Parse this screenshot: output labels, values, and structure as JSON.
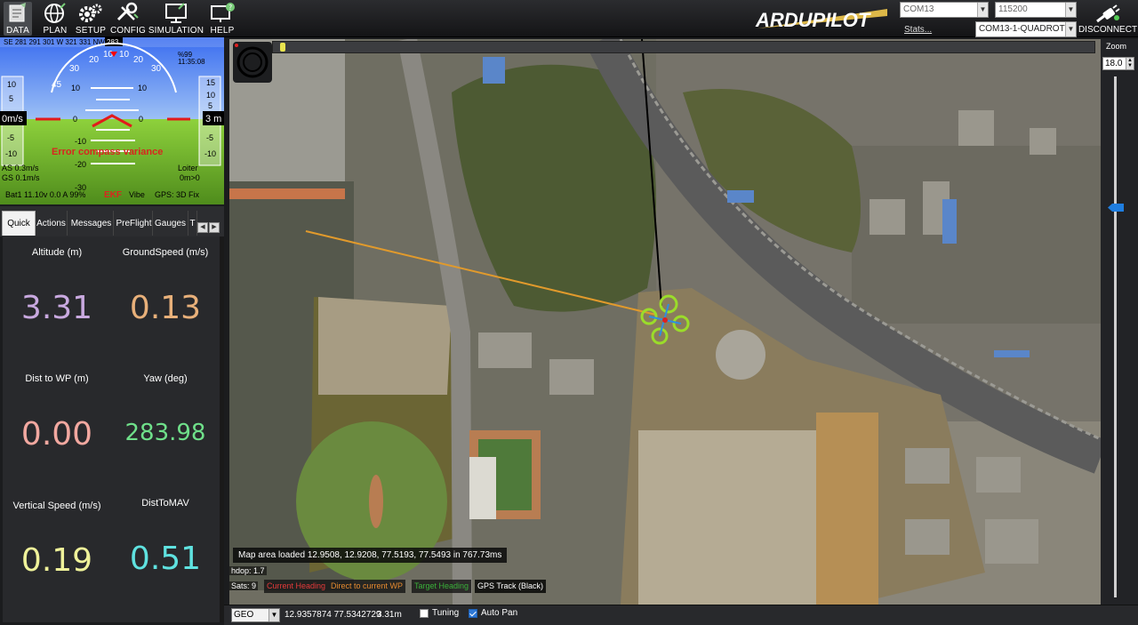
{
  "toolbar": {
    "data": "DATA",
    "plan": "PLAN",
    "setup": "SETUP",
    "config": "CONFIG",
    "simulation": "SIMULATION",
    "help": "HELP",
    "logo": "ARDUPILOT",
    "com_port": "COM13",
    "baud": "115200",
    "stats": "Stats...",
    "vehicle": "COM13-1-QUADROTOR",
    "disconnect": "DISCONNECT"
  },
  "hud": {
    "heading_row": "SE 281 291 301 W 321 331 NW 351",
    "heading_value": "283",
    "left_speed": "0m/s",
    "right_alt": "3 m",
    "pitch_labels": [
      "10",
      "0",
      "-10",
      "-20",
      "-30"
    ],
    "pitch_right": [
      "10",
      "0",
      "-10"
    ],
    "roll_labels": [
      "30",
      "20",
      "10",
      "0",
      "10",
      "20",
      "30",
      "45"
    ],
    "speed_scale": [
      "10",
      "5",
      "-5",
      "-10"
    ],
    "alt_scale": [
      "15",
      "10",
      "5",
      "-5",
      "-10"
    ],
    "error_msg": "Error compass variance",
    "as": "AS 0.3m/s",
    "gs": "GS 0.1m/s",
    "mode": "Loiter",
    "dist": "0m>0",
    "battery": "Bat1 11.10v 0.0 A 99%",
    "ekf": "EKF",
    "vibe": "Vibe",
    "gps": "GPS: 3D Fix",
    "time": "11:35:08",
    "signal": "%99"
  },
  "tabs": [
    "Quick",
    "Actions",
    "Messages",
    "PreFlight",
    "Gauges",
    "T"
  ],
  "quick": [
    {
      "label": "Altitude (m)",
      "value": "3.31",
      "color": "#c9a9e0"
    },
    {
      "label": "GroundSpeed (m/s)",
      "value": "0.13",
      "color": "#e8b07a"
    },
    {
      "label": "Dist to WP (m)",
      "value": "0.00",
      "color": "#f2a8a0"
    },
    {
      "label": "Yaw (deg)",
      "value": "283.98",
      "color": "#6fe08a"
    },
    {
      "label": "Vertical Speed (m/s)",
      "value": "0.19",
      "color": "#eff29a"
    },
    {
      "label": "DistToMAV",
      "value": "0.51",
      "color": "#5fe2e0"
    }
  ],
  "map": {
    "loaded_msg": "Map area loaded 12.9508, 12.9208, 77.5193, 77.5493 in 767.73ms",
    "hdop": "hdop: 1.7",
    "sats": "Sats: 9",
    "legend": {
      "current": "Current Heading",
      "direct": "Direct to current WP",
      "target": "Target Heading",
      "gps": "GPS Track (Black)"
    }
  },
  "zoom": {
    "label": "Zoom",
    "value": "18.0"
  },
  "status": {
    "coord_type": "GEO",
    "coords": "12.9357874 77.5342729",
    "altitude": "3.31m",
    "tuning": "Tuning",
    "autopan": "Auto Pan",
    "autopan_checked": true,
    "tuning_checked": false
  }
}
